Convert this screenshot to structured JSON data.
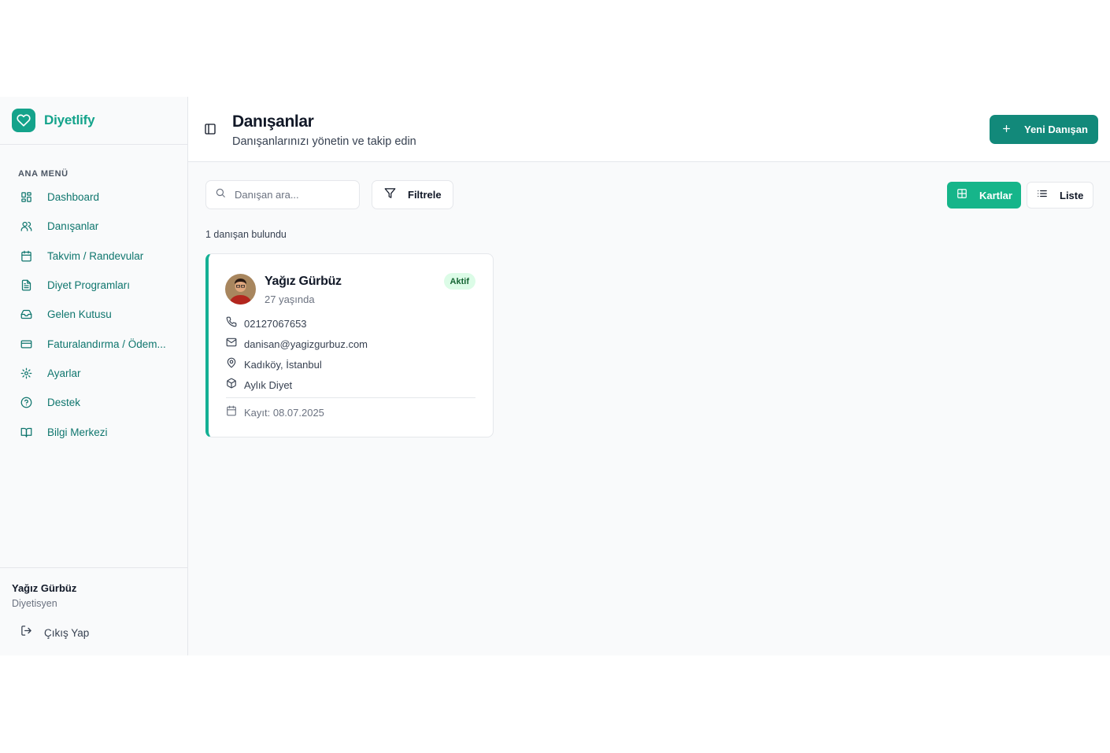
{
  "brand": {
    "name": "Diyetlify",
    "color": "#14a38b"
  },
  "sidebar": {
    "menu_title": "ANA MENÜ",
    "items": [
      {
        "label": "Dashboard",
        "icon": "dashboard-icon"
      },
      {
        "label": "Danışanlar",
        "icon": "users-icon"
      },
      {
        "label": "Takvim / Randevular",
        "icon": "calendar-icon"
      },
      {
        "label": "Diyet Programları",
        "icon": "file-text-icon"
      },
      {
        "label": "Gelen Kutusu",
        "icon": "inbox-icon"
      },
      {
        "label": "Faturalandırma / Ödem...",
        "icon": "credit-card-icon"
      },
      {
        "label": "Ayarlar",
        "icon": "gear-icon"
      },
      {
        "label": "Destek",
        "icon": "help-circle-icon"
      },
      {
        "label": "Bilgi Merkezi",
        "icon": "book-icon"
      }
    ],
    "user": {
      "name": "Yağız Gürbüz",
      "role": "Diyetisyen"
    },
    "logout_label": "Çıkış Yap"
  },
  "header": {
    "title": "Danışanlar",
    "subtitle": "Danışanlarınızı yönetin ve takip edin",
    "new_button_label": "Yeni Danışan"
  },
  "toolbar": {
    "search_placeholder": "Danışan ara...",
    "filter_label": "Filtrele",
    "view_cards_label": "Kartlar",
    "view_list_label": "Liste"
  },
  "results": {
    "count_text": "1 danışan bulundu"
  },
  "clients": [
    {
      "name": "Yağız Gürbüz",
      "age_text": "27 yaşında",
      "status": "Aktif",
      "phone": "02127067653",
      "email": "danisan@yagizgurbuz.com",
      "location": "Kadıköy, İstanbul",
      "package": "Aylık Diyet",
      "registered": "Kayıt: 08.07.2025"
    }
  ],
  "colors": {
    "accent": "#12897a",
    "active_view": "#16b58a",
    "status_bg": "#dcfce7",
    "card_border": "#14b094"
  }
}
